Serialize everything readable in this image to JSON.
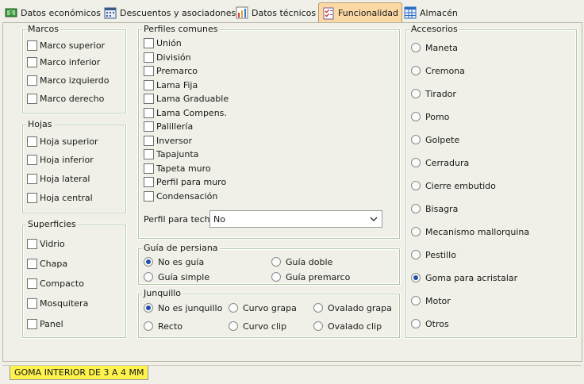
{
  "tabs": [
    {
      "label": "Datos económicos",
      "active": false
    },
    {
      "label": "Descuentos y asociadones",
      "active": false
    },
    {
      "label": "Datos técnicos",
      "active": false
    },
    {
      "label": "Funcionalidad",
      "active": true
    },
    {
      "label": "Almacén",
      "active": false
    }
  ],
  "marcos": {
    "legend": "Marcos",
    "items": [
      {
        "label": "Marco superior",
        "checked": false
      },
      {
        "label": "Marco inferior",
        "checked": false
      },
      {
        "label": "Marco izquierdo",
        "checked": false
      },
      {
        "label": "Marco derecho",
        "checked": false
      }
    ]
  },
  "hojas": {
    "legend": "Hojas",
    "items": [
      {
        "label": "Hoja superior",
        "checked": false
      },
      {
        "label": "Hoja inferior",
        "checked": false
      },
      {
        "label": "Hoja lateral",
        "checked": false
      },
      {
        "label": "Hoja central",
        "checked": false
      }
    ]
  },
  "superficies": {
    "legend": "Superficies",
    "items": [
      {
        "label": "Vidrio",
        "checked": false
      },
      {
        "label": "Chapa",
        "checked": false
      },
      {
        "label": "Compacto",
        "checked": false
      },
      {
        "label": "Mosquitera",
        "checked": false
      },
      {
        "label": "Panel",
        "checked": false
      }
    ]
  },
  "perfiles": {
    "legend": "Perfiles comunes",
    "items": [
      {
        "label": "Unión",
        "checked": false
      },
      {
        "label": "División",
        "checked": false
      },
      {
        "label": "Premarco",
        "checked": false
      },
      {
        "label": "Lama Fija",
        "checked": false
      },
      {
        "label": "Lama Graduable",
        "checked": false
      },
      {
        "label": "Lama Compens.",
        "checked": false
      },
      {
        "label": "Palillería",
        "checked": false
      },
      {
        "label": "Inversor",
        "checked": false
      },
      {
        "label": "Tapajunta",
        "checked": false
      },
      {
        "label": "Tapeta muro",
        "checked": false
      },
      {
        "label": "Perfil para muro",
        "checked": false
      },
      {
        "label": "Condensación",
        "checked": false
      }
    ],
    "techo_label": "Perfil para techo",
    "techo_value": "No"
  },
  "persiana": {
    "legend": "Guía de persiana",
    "options": [
      {
        "label": "No es guía",
        "selected": true
      },
      {
        "label": "Guía doble",
        "selected": false
      },
      {
        "label": "Guía simple",
        "selected": false
      },
      {
        "label": "Guía premarco",
        "selected": false
      }
    ]
  },
  "junquillo": {
    "legend": "Junquillo",
    "options": [
      {
        "label": "No es junquillo",
        "selected": true
      },
      {
        "label": "Curvo grapa",
        "selected": false
      },
      {
        "label": "Ovalado grapa",
        "selected": false
      },
      {
        "label": "Recto",
        "selected": false
      },
      {
        "label": "Curvo clip",
        "selected": false
      },
      {
        "label": "Ovalado clip",
        "selected": false
      }
    ]
  },
  "accesorios": {
    "legend": "Accesorios",
    "options": [
      {
        "label": "Maneta",
        "selected": false
      },
      {
        "label": "Cremona",
        "selected": false
      },
      {
        "label": "Tirador",
        "selected": false
      },
      {
        "label": "Pomo",
        "selected": false
      },
      {
        "label": "Golpete",
        "selected": false
      },
      {
        "label": "Cerradura",
        "selected": false
      },
      {
        "label": "Cierre embutido",
        "selected": false
      },
      {
        "label": "Bisagra",
        "selected": false
      },
      {
        "label": "Mecanismo mallorquina",
        "selected": false
      },
      {
        "label": "Pestillo",
        "selected": false
      },
      {
        "label": "Goma para acristalar",
        "selected": true
      },
      {
        "label": "Motor",
        "selected": false
      },
      {
        "label": "Otros",
        "selected": false
      }
    ]
  },
  "status": {
    "label": "GOMA INTERIOR DE 3 A 4 MM"
  },
  "colors": {
    "active_tab": "#fcd8a4",
    "status_tab": "#fef24c",
    "group_border": "#b3c7a4",
    "radio_dot": "#1f4ea8"
  },
  "icons": [
    "money-icon",
    "calendar-icon",
    "chart-icon",
    "checklist-icon",
    "grid-icon",
    "chevron-down-icon"
  ]
}
